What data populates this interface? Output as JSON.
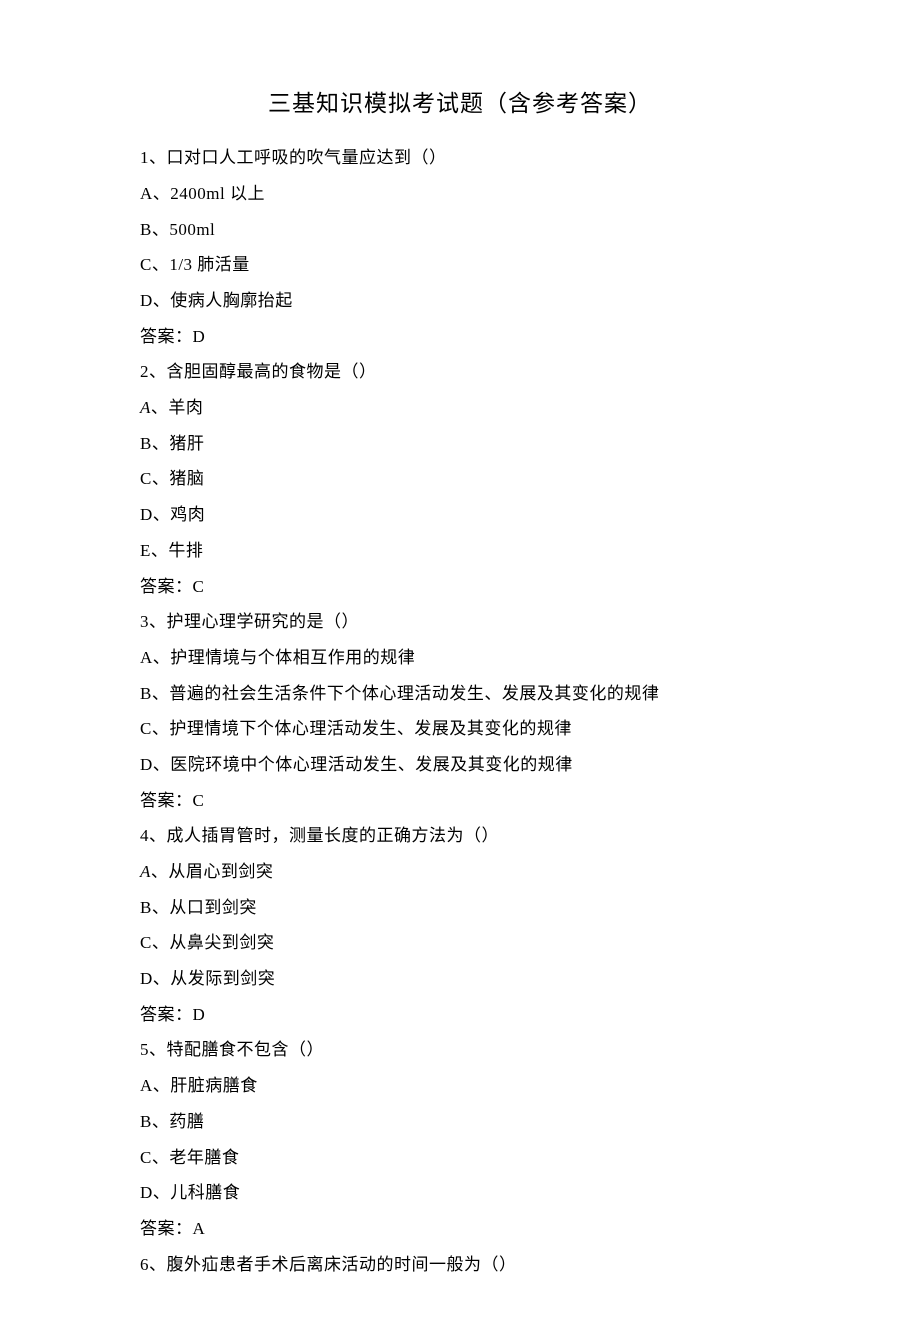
{
  "title": "三基知识模拟考试题（含参考答案）",
  "content": {
    "q1": {
      "stem": "1、口对口人工呼吸的吹气量应达到（）",
      "a": "A、2400ml 以上",
      "b": "B、500ml",
      "c": "C、1/3 肺活量",
      "d": "D、使病人胸廓抬起",
      "ans": "答案：D"
    },
    "q2": {
      "stem": "2、含胆固醇最高的食物是（）",
      "a": "A、羊肉",
      "b": "B、猪肝",
      "c": "C、猪脑",
      "d": "D、鸡肉",
      "e": "E、牛排",
      "ans": "答案：C"
    },
    "q3": {
      "stem": "3、护理心理学研究的是（）",
      "a": "A、护理情境与个体相互作用的规律",
      "b": "B、普遍的社会生活条件下个体心理活动发生、发展及其变化的规律",
      "c": "C、护理情境下个体心理活动发生、发展及其变化的规律",
      "d": "D、医院环境中个体心理活动发生、发展及其变化的规律",
      "ans": "答案：C"
    },
    "q4": {
      "stem": "4、成人插胃管时，测量长度的正确方法为（）",
      "a": "A、从眉心到剑突",
      "b": "B、从口到剑突",
      "c": "C、从鼻尖到剑突",
      "d": "D、从发际到剑突",
      "ans": "答案：D"
    },
    "q5": {
      "stem": "5、特配膳食不包含（）",
      "a": "A、肝脏病膳食",
      "b": "B、药膳",
      "c": "C、老年膳食",
      "d": "D、儿科膳食",
      "ans": "答案：A"
    },
    "q6": {
      "stem": "6、腹外疝患者手术后离床活动的时间一般为（）"
    }
  }
}
